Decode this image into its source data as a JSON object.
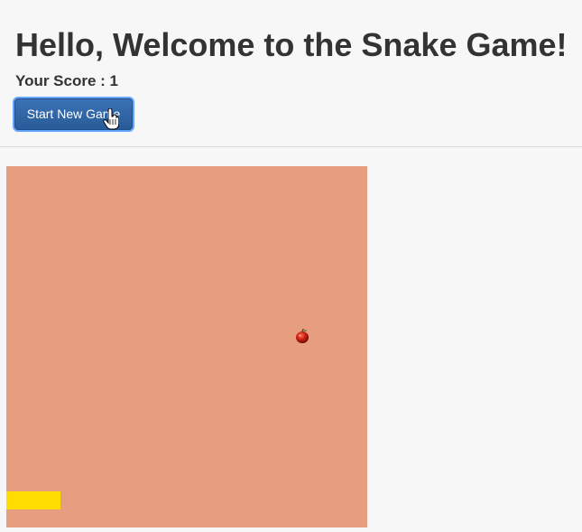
{
  "header": {
    "title": "Hello, Welcome to the Snake Game!",
    "score_label": "Your Score : 1",
    "start_button_label": "Start New Game"
  },
  "colors": {
    "page_background": "#f7f7f7",
    "board_background": "#e79d80",
    "snake": "#ffdd00",
    "button": "#285b98",
    "button_focus_ring": "#66a6ff"
  },
  "board": {
    "snake_length_cells": 3,
    "food_item": "apple-icon"
  }
}
